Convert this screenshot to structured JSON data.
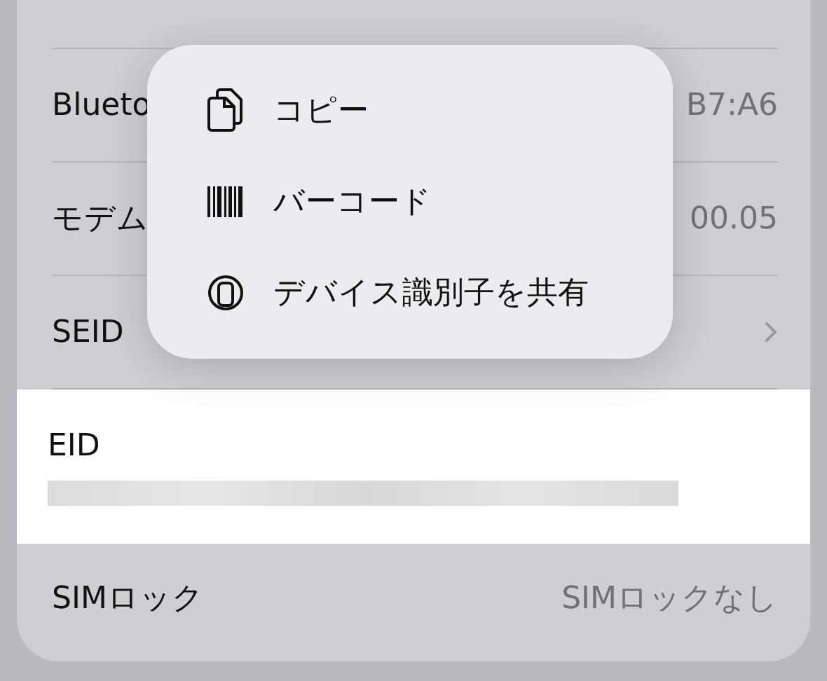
{
  "rows": [
    {
      "label": "Blueto",
      "value": "B7:A6",
      "kind": "value"
    },
    {
      "label": "モデム",
      "value": "00.05",
      "kind": "value"
    },
    {
      "label": "SEID",
      "kind": "link"
    },
    {
      "label": "EID",
      "kind": "redacted",
      "selected": true
    },
    {
      "label": "SIMロック",
      "value": "SIMロックなし",
      "kind": "value"
    }
  ],
  "menu": [
    {
      "label": "コピー",
      "kind": "copy"
    },
    {
      "label": "バーコード",
      "kind": "barcode"
    },
    {
      "label": "デバイス識別子を共有",
      "kind": "share"
    }
  ]
}
